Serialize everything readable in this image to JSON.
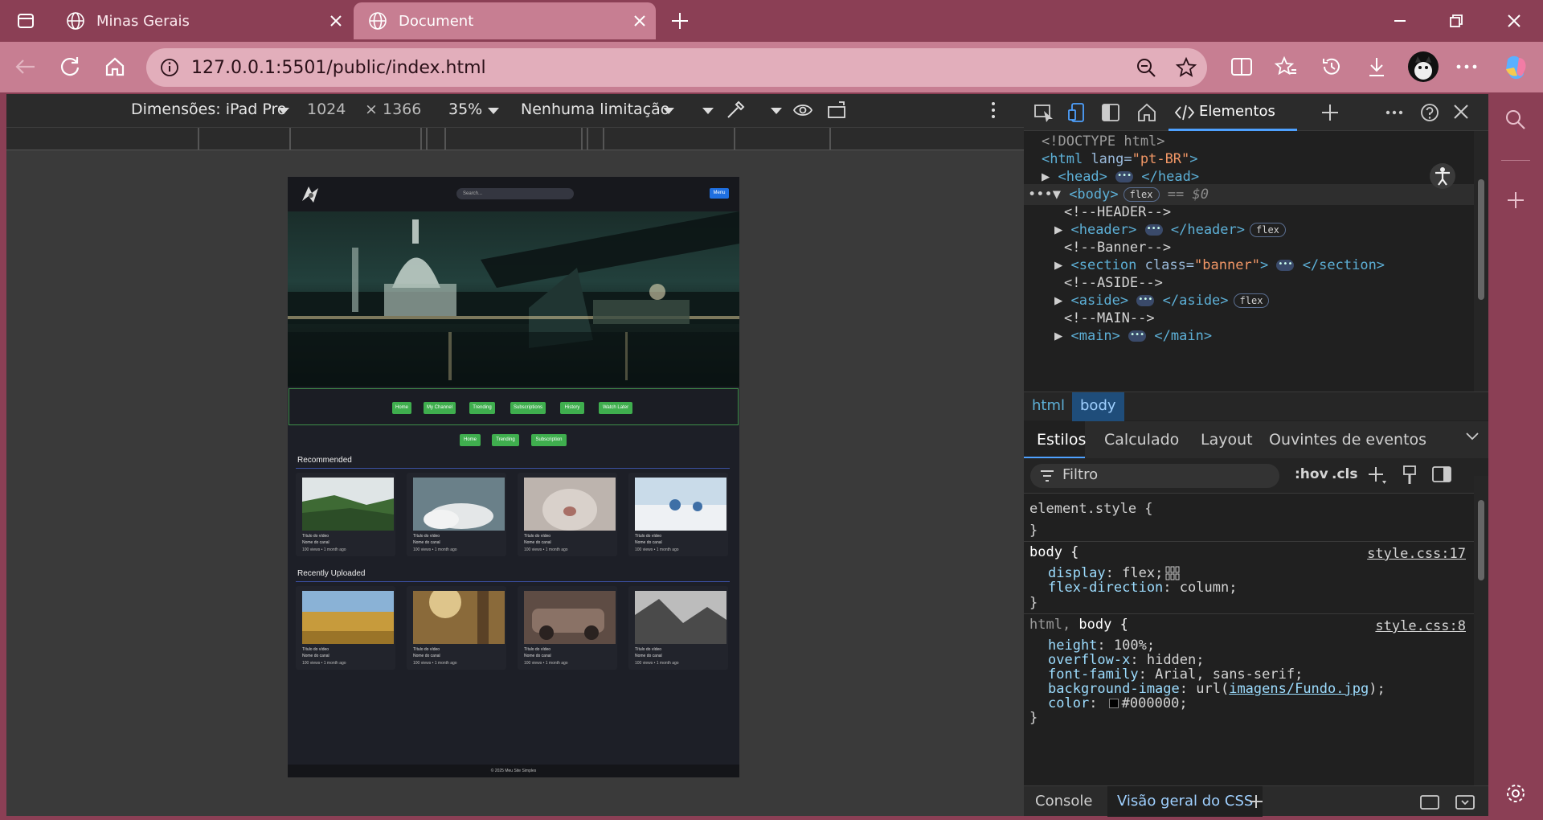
{
  "browser": {
    "tabs": [
      {
        "title": "Minas Gerais",
        "active": false
      },
      {
        "title": "Document",
        "active": true
      }
    ],
    "url": "127.0.0.1:5501/public/index.html"
  },
  "device_toolbar": {
    "dimensions_label": "Dimensões: iPad Pro",
    "width": "1024",
    "times": "×",
    "height": "1366",
    "zoom": "35%",
    "throttle": "Nenhuma limitação"
  },
  "site": {
    "search_placeholder": "Search...",
    "top_button": "Menu",
    "nav_buttons": [
      "Home",
      "My Channel",
      "Trending",
      "Subscriptions",
      "History",
      "Watch Later"
    ],
    "sub_buttons": [
      "Home",
      "Trending",
      "Subscription"
    ],
    "sections": [
      {
        "title": "Recommended",
        "cards": [
          {
            "title": "Título do vídeo",
            "channel": "Nome do canal",
            "meta": "100 views • 1 month ago"
          },
          {
            "title": "Título do vídeo",
            "channel": "Nome do canal",
            "meta": "100 views • 1 month ago"
          },
          {
            "title": "Título do vídeo",
            "channel": "Nome do canal",
            "meta": "100 views • 1 month ago"
          },
          {
            "title": "Título do vídeo",
            "channel": "Nome do canal",
            "meta": "100 views • 1 month ago"
          }
        ]
      },
      {
        "title": "Recently Uploaded",
        "cards": [
          {
            "title": "Título do vídeo",
            "channel": "Nome do canal",
            "meta": "100 views • 1 month ago"
          },
          {
            "title": "Título do vídeo",
            "channel": "Nome do canal",
            "meta": "100 views • 1 month ago"
          },
          {
            "title": "Título do vídeo",
            "channel": "Nome do canal",
            "meta": "100 views • 1 month ago"
          },
          {
            "title": "Título do vídeo",
            "channel": "Nome do canal",
            "meta": "100 views • 1 month ago"
          }
        ]
      }
    ],
    "footer": "© 2025 Meu Site Simples"
  },
  "devtools": {
    "active_tool": "Elementos",
    "dom": {
      "doctype": "<!DOCTYPE html>",
      "html_open": "<html",
      "html_attr": "lang=",
      "html_val": "\"pt-BR\"",
      "html_close": ">",
      "head_open": "<head>",
      "head_close": "</head>",
      "body_tag": "<body>",
      "body_flex": "flex",
      "body_eq": "== $0",
      "c_header": "<!--HEADER-->",
      "header_open": "<header>",
      "header_close": "</header>",
      "header_flex": "flex",
      "c_banner": "<!--Banner-->",
      "section_open": "<section",
      "section_attr": "class=",
      "section_val": "\"banner\"",
      "section_gt": ">",
      "section_close": "</section>",
      "c_aside": "<!--ASIDE-->",
      "aside_open": "<aside>",
      "aside_close": "</aside>",
      "aside_flex": "flex",
      "c_main": "<!--MAIN-->",
      "main_open": "<main>",
      "main_close": "</main>"
    },
    "breadcrumb": [
      "html",
      "body"
    ],
    "style_tabs": [
      "Estilos",
      "Calculado",
      "Layout",
      "Ouvintes de eventos"
    ],
    "filter_placeholder": "Filtro",
    "hov": ":hov",
    "cls": ".cls",
    "rules": {
      "element_style": "element.style {",
      "close": "}",
      "body_selector": "body {",
      "body_link": "style.css:17",
      "body_props": [
        {
          "prop": "display",
          "value": "flex;"
        },
        {
          "prop": "flex-direction",
          "value": "column;"
        }
      ],
      "htmlbody_selector_a": "html, ",
      "htmlbody_selector_b": "body {",
      "htmlbody_link": "style.css:8",
      "htmlbody_props": [
        {
          "prop": "height",
          "value": "100%;"
        },
        {
          "prop": "overflow-x",
          "value": "hidden;"
        },
        {
          "prop": "font-family",
          "value": "Arial, sans-serif;"
        },
        {
          "prop": "background-image",
          "value_a": "url(",
          "link": "imagens/Fundo.jpg",
          "value_b": ");"
        },
        {
          "prop": "color",
          "value": "#000000;"
        }
      ]
    },
    "drawer_tabs": [
      "Console",
      "Visão geral do CSS"
    ]
  },
  "colors": {
    "frame": "#8b3f55",
    "toolbar": "#c77e92",
    "accent_green": "#3fae4e",
    "accent_blue": "#1f6fe0"
  }
}
